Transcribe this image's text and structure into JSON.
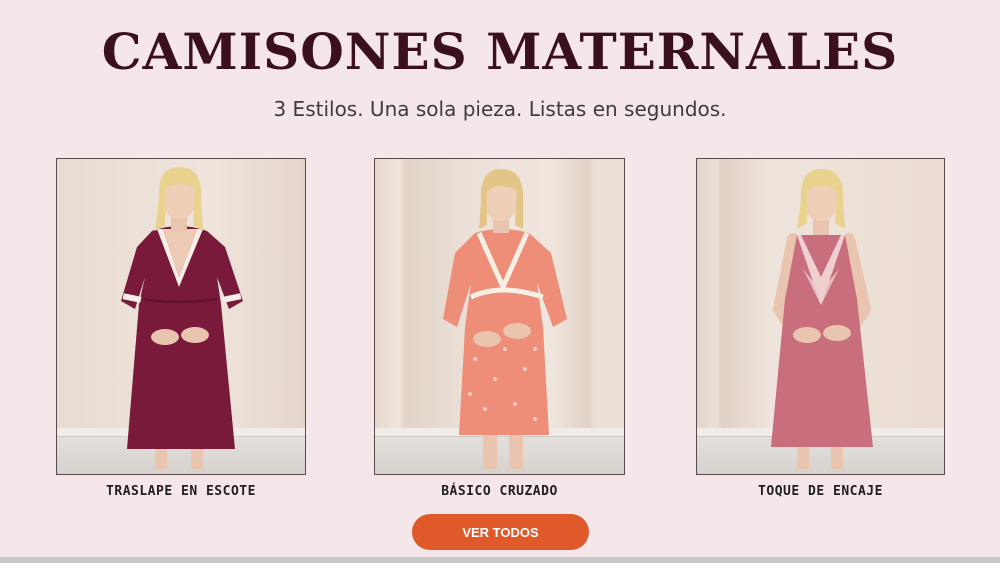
{
  "header": {
    "title": "CAMISONES MATERNALES",
    "subtitle": "3 Estilos. Una sola pieza. Listas en segundos."
  },
  "products": [
    {
      "label": "TRASLAPE EN ESCOTE",
      "dress_color": "#7a1a3a",
      "trim_color": "#f4eee6"
    },
    {
      "label": "BÁSICO CRUZADO",
      "dress_color": "#ee8e78",
      "trim_color": "#f6efe4"
    },
    {
      "label": "TOQUE DE ENCAJE",
      "dress_color": "#c86e7c",
      "trim_color": "#efcfcf"
    }
  ],
  "cta": {
    "label": "VER TODOS"
  },
  "colors": {
    "background": "#f5e6e9",
    "title": "#3a0f1e",
    "cta": "#e0592a"
  }
}
